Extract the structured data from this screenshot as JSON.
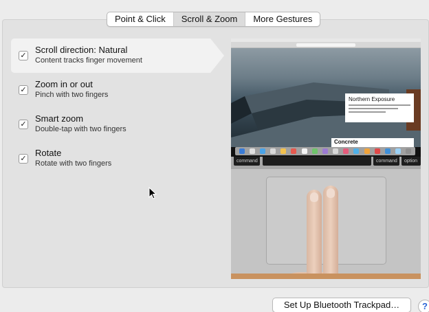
{
  "tabs": [
    {
      "label": "Point & Click",
      "selected": false
    },
    {
      "label": "Scroll & Zoom",
      "selected": true
    },
    {
      "label": "More Gestures",
      "selected": false
    }
  ],
  "options": [
    {
      "title": "Scroll direction: Natural",
      "description": "Content tracks finger movement",
      "checked": true,
      "highlighted": true
    },
    {
      "title": "Zoom in or out",
      "description": "Pinch with two fingers",
      "checked": true,
      "highlighted": false
    },
    {
      "title": "Smart zoom",
      "description": "Double-tap with two fingers",
      "checked": true,
      "highlighted": false
    },
    {
      "title": "Rotate",
      "description": "Rotate with two fingers",
      "checked": true,
      "highlighted": false
    }
  ],
  "preview": {
    "article_title": "Northern Exposure",
    "article_secondary": "Concrete",
    "keys": {
      "command_left": "command",
      "command_right": "command",
      "option_right": "option"
    }
  },
  "footer": {
    "setup_button_label": "Set Up Bluetooth Trackpad…",
    "help_icon": "question-mark-icon",
    "help_label": "?"
  },
  "colors": {
    "panel_bg": "#e2e2e2",
    "window_bg": "#ececec",
    "help_accent": "#2a64d6"
  }
}
